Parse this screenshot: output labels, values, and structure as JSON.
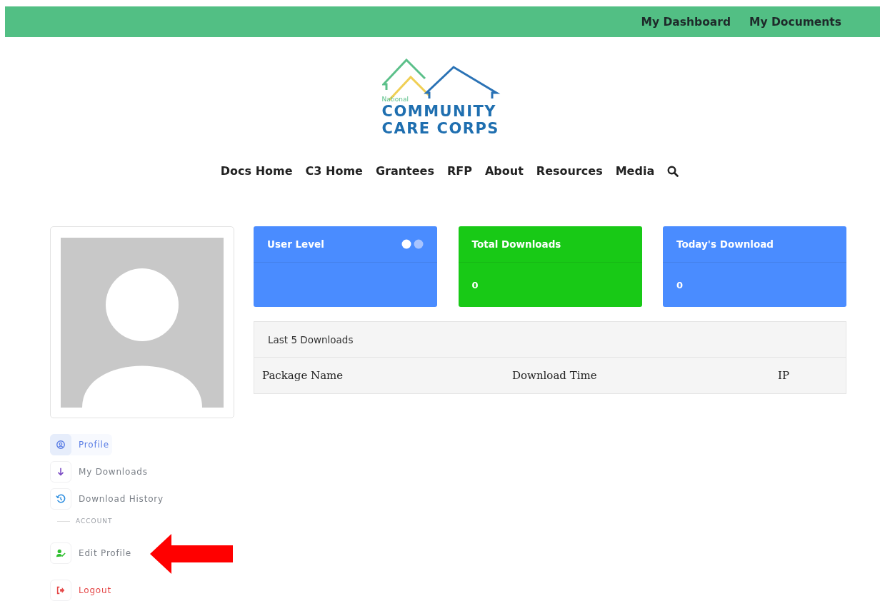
{
  "top_bar": {
    "links": [
      "My Dashboard",
      "My Documents"
    ]
  },
  "logo": {
    "small": "National",
    "line_1": "COMMUNITY",
    "line_2": "CARE CORPS"
  },
  "nav": {
    "items": [
      "Docs Home",
      "C3 Home",
      "Grantees",
      "RFP",
      "About",
      "Resources",
      "Media"
    ]
  },
  "stat_cards": [
    {
      "title": "User Level",
      "color": "#4a8cff",
      "kind": "toggle"
    },
    {
      "title": "Total Downloads",
      "value": "0",
      "color": "#18c916",
      "kind": "plain"
    },
    {
      "title": "Today's Download",
      "value": "0",
      "color": "#4a8cff",
      "kind": "plain"
    }
  ],
  "downloads": {
    "title": "Last 5 Downloads",
    "columns": [
      "Package Name",
      "Download Time",
      "IP"
    ]
  },
  "sidebar": {
    "sections": [
      {
        "items": [
          {
            "label": "Profile",
            "kind": "profile",
            "selected": true
          },
          {
            "label": "My Downloads",
            "kind": "download",
            "selected": false
          },
          {
            "label": "Download History",
            "kind": "history",
            "selected": false
          }
        ]
      },
      {
        "heading": "ACCOUNT",
        "items": [
          {
            "label": "Edit Profile",
            "kind": "edit",
            "selected": false
          },
          {
            "label": "Logout",
            "kind": "logout",
            "selected": false
          }
        ]
      }
    ]
  }
}
